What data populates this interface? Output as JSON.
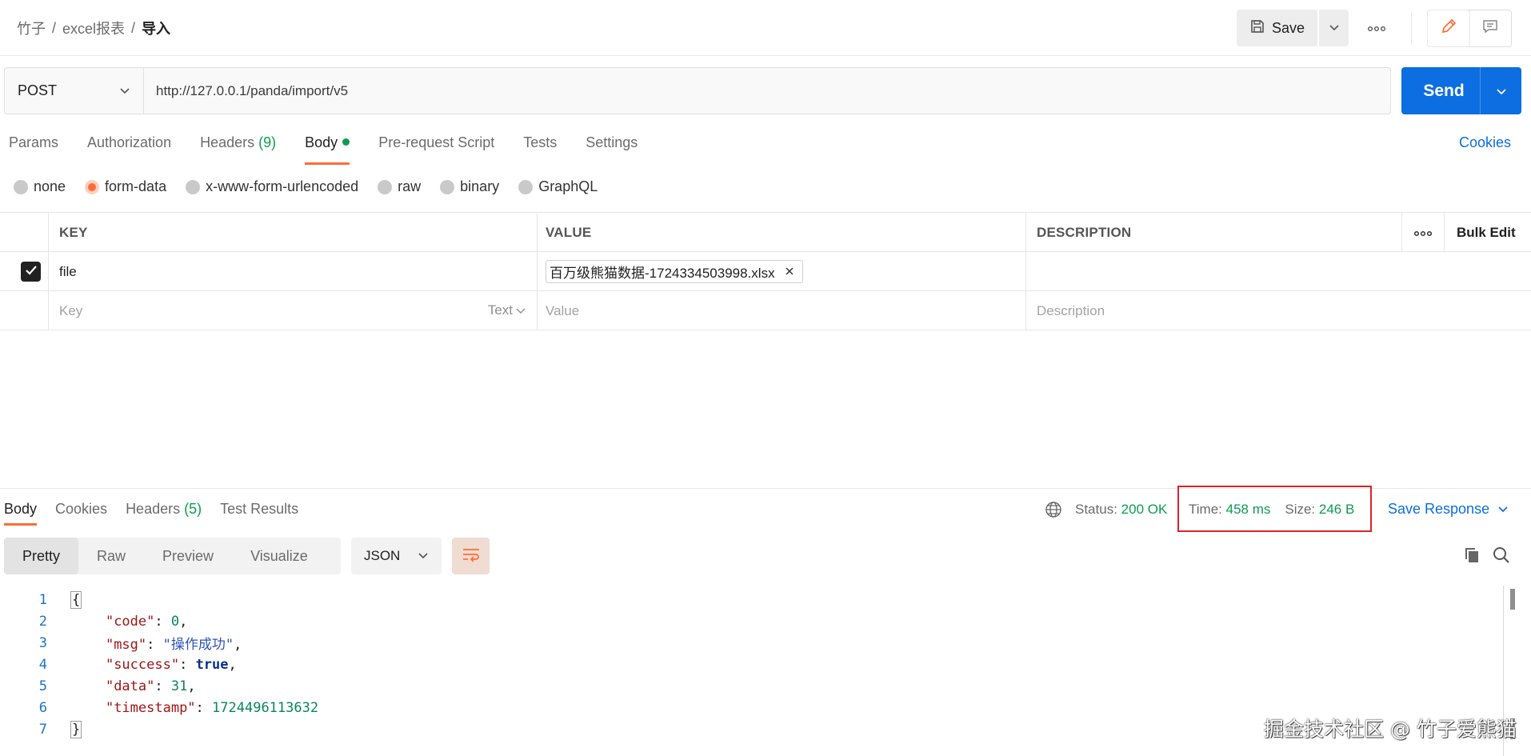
{
  "breadcrumb": {
    "items": [
      "竹子",
      "excel报表"
    ],
    "current": "导入",
    "separator": "/"
  },
  "toolbar": {
    "save_label": "Save",
    "more_label": "ooo"
  },
  "request": {
    "method": "POST",
    "url": "http://127.0.0.1/panda/import/v5",
    "send_label": "Send"
  },
  "tabs": {
    "params": "Params",
    "authorization": "Authorization",
    "headers": "Headers",
    "headers_count": "(9)",
    "body": "Body",
    "prerequest": "Pre-request Script",
    "tests": "Tests",
    "settings": "Settings",
    "cookies": "Cookies"
  },
  "body_types": [
    "none",
    "form-data",
    "x-www-form-urlencoded",
    "raw",
    "binary",
    "GraphQL"
  ],
  "body_type_selected": "form-data",
  "form_table": {
    "headers": {
      "key": "KEY",
      "value": "VALUE",
      "description": "DESCRIPTION",
      "more": "ooo",
      "bulk_edit": "Bulk Edit"
    },
    "rows": [
      {
        "checked": true,
        "key": "file",
        "value": "百万级熊猫数据-1724334503998.xlsx",
        "description": ""
      }
    ],
    "new_row": {
      "key_placeholder": "Key",
      "type": "Text",
      "value_placeholder": "Value",
      "description_placeholder": "Description"
    }
  },
  "response": {
    "tabs": {
      "body": "Body",
      "cookies": "Cookies",
      "headers": "Headers",
      "headers_count": "(5)",
      "test_results": "Test Results"
    },
    "status_label": "Status:",
    "status_value": "200 OK",
    "time_label": "Time:",
    "time_value": "458 ms",
    "size_label": "Size:",
    "size_value": "246 B",
    "save_response": "Save Response",
    "views": [
      "Pretty",
      "Raw",
      "Preview",
      "Visualize"
    ],
    "view_selected": "Pretty",
    "format": "JSON",
    "code": {
      "line_numbers": [
        "1",
        "2",
        "3",
        "4",
        "5",
        "6",
        "7"
      ],
      "open": "{",
      "close": "}",
      "fields": [
        {
          "key": "\"code\"",
          "value": "0"
        },
        {
          "key": "\"msg\"",
          "value": "\"操作成功\""
        },
        {
          "key": "\"success\"",
          "value": "true"
        },
        {
          "key": "\"data\"",
          "value": "31"
        },
        {
          "key": "\"timestamp\"",
          "value": "1724496113632"
        }
      ]
    }
  },
  "watermark": "掘金技术社区 @ 竹子爱熊猫",
  "colors": {
    "accent": "#ff6c37",
    "primary": "#0c6ee0",
    "success": "#0d9b52",
    "highlight": "#d9242b"
  },
  "icons": [
    "save-icon",
    "chevron-down-icon",
    "more-icon",
    "edit-icon",
    "comment-icon",
    "globe-icon",
    "wrap-icon",
    "copy-icon",
    "search-icon",
    "close-icon",
    "check-icon"
  ]
}
